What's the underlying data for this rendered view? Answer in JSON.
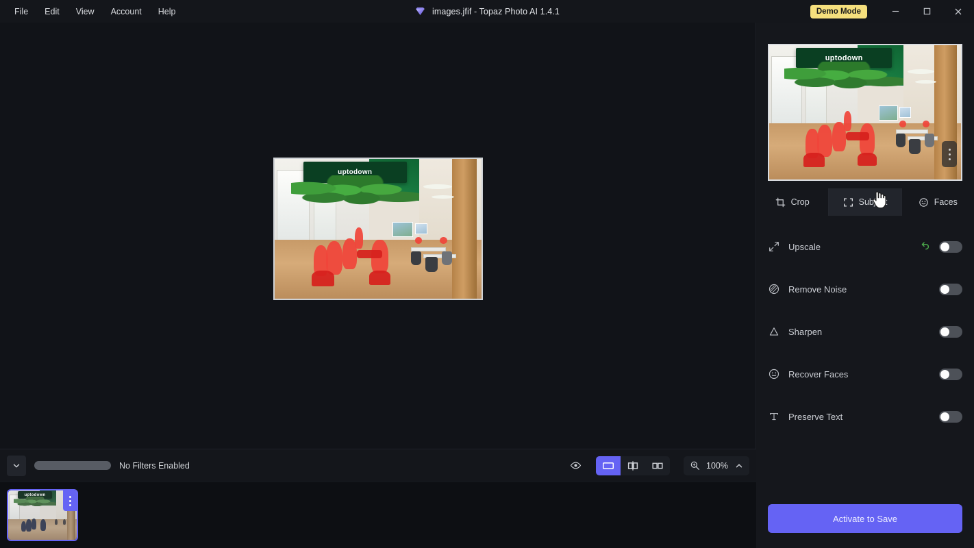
{
  "window": {
    "title": "images.jfif - Topaz Photo AI 1.4.1",
    "logo_icon": "gem-icon",
    "demo_badge": "Demo Mode",
    "minimize_icon": "minimize-icon",
    "maximize_icon": "maximize-icon",
    "close_icon": "close-icon"
  },
  "menubar": {
    "items": [
      {
        "label": "File"
      },
      {
        "label": "Edit"
      },
      {
        "label": "View"
      },
      {
        "label": "Account"
      },
      {
        "label": "Help"
      }
    ]
  },
  "image": {
    "sign_text": "uptodown",
    "alt": "office interior with uptodown sign, green ceiling, hanging plants and people highlighted in red as selected subjects"
  },
  "filterbar": {
    "collapse_icon": "chevron-down-icon",
    "status": "No Filters Enabled",
    "preview_eye_icon": "eye-icon",
    "view_modes": [
      {
        "name": "single-view",
        "icon": "single-pane-icon",
        "active": true
      },
      {
        "name": "split-view",
        "icon": "split-pane-icon",
        "active": false
      },
      {
        "name": "side-by-side-view",
        "icon": "dual-pane-icon",
        "active": false
      }
    ],
    "zoom_icon": "zoom-magnifier-icon",
    "zoom_level": "100%",
    "zoom_chevron_icon": "chevron-up-icon"
  },
  "filmstrip": {
    "thumbnail_menu_icon": "more-vertical-icon"
  },
  "panel": {
    "preview_menu_icon": "more-vertical-icon",
    "tabs": [
      {
        "label": "Crop",
        "icon": "crop-icon",
        "hovered": false
      },
      {
        "label": "Subject",
        "icon": "subject-select-icon",
        "hovered": true
      },
      {
        "label": "Faces",
        "icon": "face-smile-icon",
        "hovered": false
      }
    ],
    "filters": [
      {
        "label": "Upscale",
        "icon": "expand-diagonal-icon",
        "enabled": false,
        "has_undo": true,
        "undo_icon": "undo-arrow-icon"
      },
      {
        "label": "Remove Noise",
        "icon": "noise-circle-icon",
        "enabled": false,
        "has_undo": false
      },
      {
        "label": "Sharpen",
        "icon": "triangle-icon",
        "enabled": false,
        "has_undo": false
      },
      {
        "label": "Recover Faces",
        "icon": "face-smile-icon",
        "enabled": false,
        "has_undo": false
      },
      {
        "label": "Preserve Text",
        "icon": "text-t-icon",
        "enabled": false,
        "has_undo": false
      }
    ],
    "save_button": "Activate to Save"
  },
  "colors": {
    "accent": "#6563f4",
    "demo_badge_bg": "#f5df7d",
    "undo_green": "#4dae4d",
    "panel_bg": "#15171c",
    "titlebar_bg": "#14161b",
    "canvas_bg": "#111318"
  }
}
